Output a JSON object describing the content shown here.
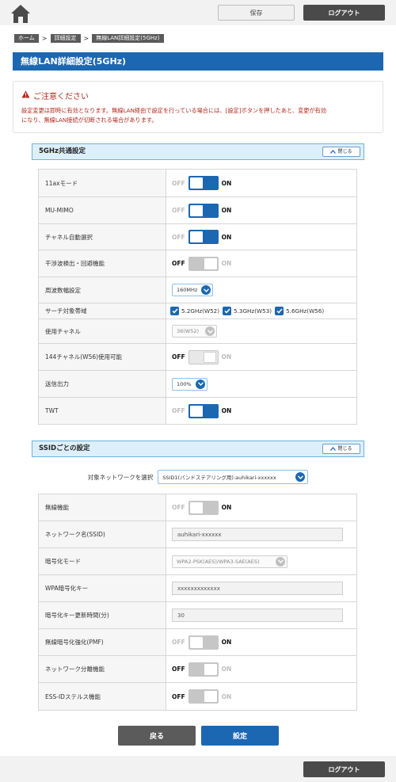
{
  "header": {
    "save_label": "保存",
    "logout_label": "ログアウト"
  },
  "breadcrumb": [
    "ホーム",
    "詳細設定",
    "無線LAN詳細設定(5GHz)"
  ],
  "page_title": "無線LAN詳細設定(5GHz)",
  "notice": {
    "title": "ご注意ください",
    "line1": "設定変更は即時に有効となります。無線LAN経由で設定を行っている場合には、[設定]ボタンを押したあと、変更が有効",
    "line2": "になり、無線LAN接続が切断される場合があります。"
  },
  "common": {
    "title": "5GHz共通設定",
    "close_label": "閉じる",
    "rows": {
      "ax_mode": "11axモード",
      "mu_mimo": "MU-MIMO",
      "auto_channel": "チャネル自動選択",
      "interference": "干渉波検出・回避機能",
      "bandwidth": "周波数幅設定",
      "search_band": "サーチ対象帯域",
      "channel": "使用チャネル",
      "ch144": "144チャネル(W56)使用可能",
      "tx_power": "送信出力",
      "twt": "TWT"
    },
    "bandwidth_value": "160MHz",
    "bands": [
      "5.2GHz(W52)",
      "5.3GHz(W53)",
      "5.6GHz(W56)"
    ],
    "channel_value": "36(W52)",
    "tx_power_value": "100%"
  },
  "toggle": {
    "off": "OFF",
    "on": "ON"
  },
  "ssid": {
    "title": "SSIDごとの設定",
    "close_label": "閉じる",
    "target_label": "対象ネットワークを選択",
    "target_value": "SSID1(バンドステアリング用):auhikari-xxxxxx",
    "rows": {
      "wireless": "無線機能",
      "name": "ネットワーク名(SSID)",
      "enc_mode": "暗号化モード",
      "wpa_key": "WPA暗号化キー",
      "rekey": "暗号化キー更新時間(分)",
      "pmf": "無線暗号化強化(PMF)",
      "isolation": "ネットワーク分離機能",
      "stealth": "ESS-IDステルス機能"
    },
    "name_value": "auhikari-xxxxxx",
    "enc_value": "WPA2-PSK(AES)/WPA3-SAE(AES)",
    "key_value": "xxxxxxxxxxxxx",
    "rekey_value": "30"
  },
  "buttons": {
    "back": "戻る",
    "set": "設定"
  },
  "colors": {
    "primary": "#1c67b2",
    "notice": "#b22a1e",
    "dark": "#4a4a4a"
  }
}
